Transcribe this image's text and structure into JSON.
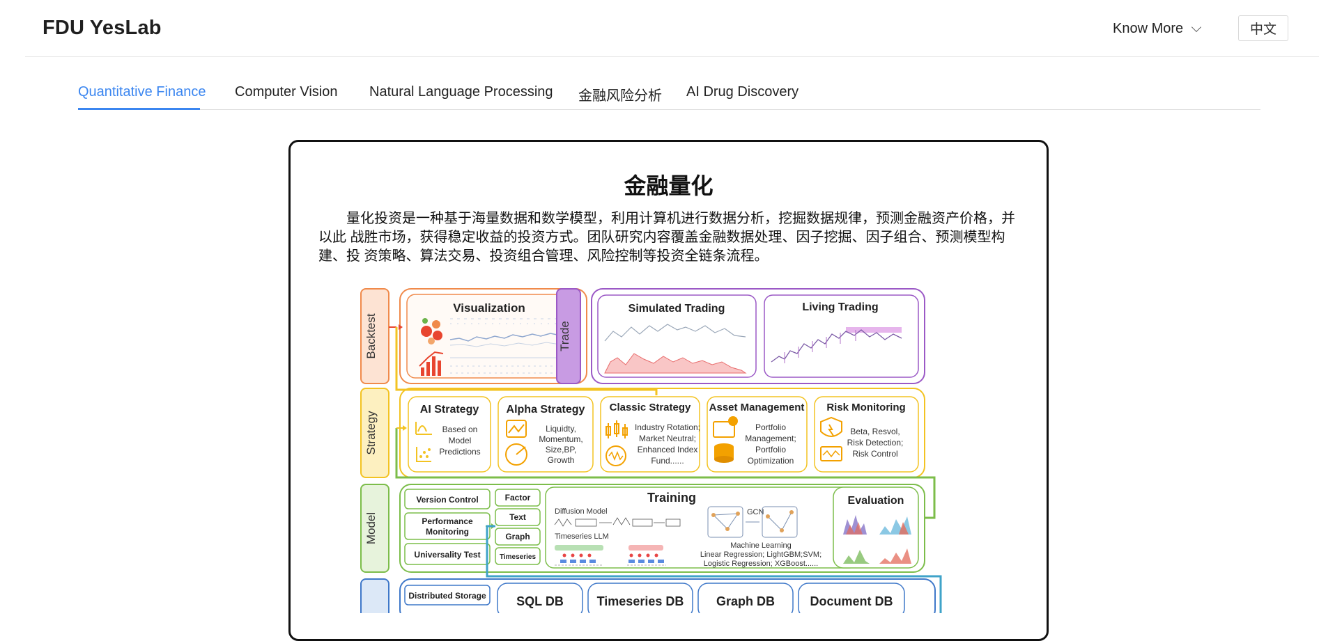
{
  "header": {
    "brand": "FDU YesLab",
    "know_more_label": "Know More",
    "lang_label": "中文"
  },
  "tabs": [
    {
      "label": "Quantitative Finance",
      "active": true
    },
    {
      "label": "Computer Vision",
      "active": false
    },
    {
      "label": "Natural Language Processing",
      "active": false
    },
    {
      "label": "金融风险分析",
      "active": false
    },
    {
      "label": "AI Drug Discovery",
      "active": false
    }
  ],
  "card": {
    "title": "金融量化",
    "description": "量化投资是一种基于海量数据和数学模型，利用计算机进行数据分析，挖掘数据规律，预测金融资产价格，并以此 战胜市场，获得稳定收益的投资方式。团队研究内容覆盖金融数据处理、因子挖掘、因子组合、预测模型构建、投 资策略、算法交易、投资组合管理、风险控制等投资全链条流程。"
  },
  "diagram": {
    "layers": {
      "backtest": "Backtest",
      "trade": "Trade",
      "strategy": "Strategy",
      "model": "Model"
    },
    "backtest": {
      "visualization": "Visualization"
    },
    "trade": {
      "simulated": "Simulated Trading",
      "living": "Living Trading"
    },
    "strategy": {
      "ai": {
        "title": "AI Strategy",
        "lines": [
          "Based on",
          "Model",
          "Predictions"
        ]
      },
      "alpha": {
        "title": "Alpha Strategy",
        "lines": [
          "Liquidty,",
          "Momentum,",
          "Size,BP,",
          "Growth"
        ]
      },
      "classic": {
        "title": "Classic Strategy",
        "lines": [
          "Industry Rotation;",
          "Market Neutral;",
          "Enhanced Index",
          "Fund......"
        ]
      },
      "asset": {
        "title": "Asset Management",
        "lines": [
          "Portfolio",
          "Management;",
          "Portfolio",
          "Optimization"
        ]
      },
      "risk": {
        "title": "Risk Monitoring",
        "lines": [
          "Beta, Resvol,",
          "Risk Detection;",
          "Risk Control"
        ]
      }
    },
    "model": {
      "left": [
        "Version Control",
        "Performance",
        "Monitoring",
        "Universality Test"
      ],
      "inputs": [
        "Factor",
        "Text",
        "Graph",
        "Timeseries"
      ],
      "training": {
        "title": "Training",
        "diffusion": "Diffusion Model",
        "ts_llm": "Timeseries LLM",
        "gcn": "GCN",
        "ml_title": "Machine Learning",
        "ml_line1": "Linear Regression; LightGBM;SVM;",
        "ml_line2": "Logistic Regression; XGBoost......"
      },
      "evaluation": "Evaluation"
    },
    "data": {
      "storage": "Distributed Storage",
      "dbs": [
        "SQL DB",
        "Timeseries DB",
        "Graph DB",
        "Document DB"
      ]
    },
    "colors": {
      "backtest": "#f08a4b",
      "trade": "#9b59c6",
      "strategy": "#f3c322",
      "model": "#7cbd4a",
      "data": "#3f78c9",
      "accent_blue": "#3b86f0"
    }
  }
}
